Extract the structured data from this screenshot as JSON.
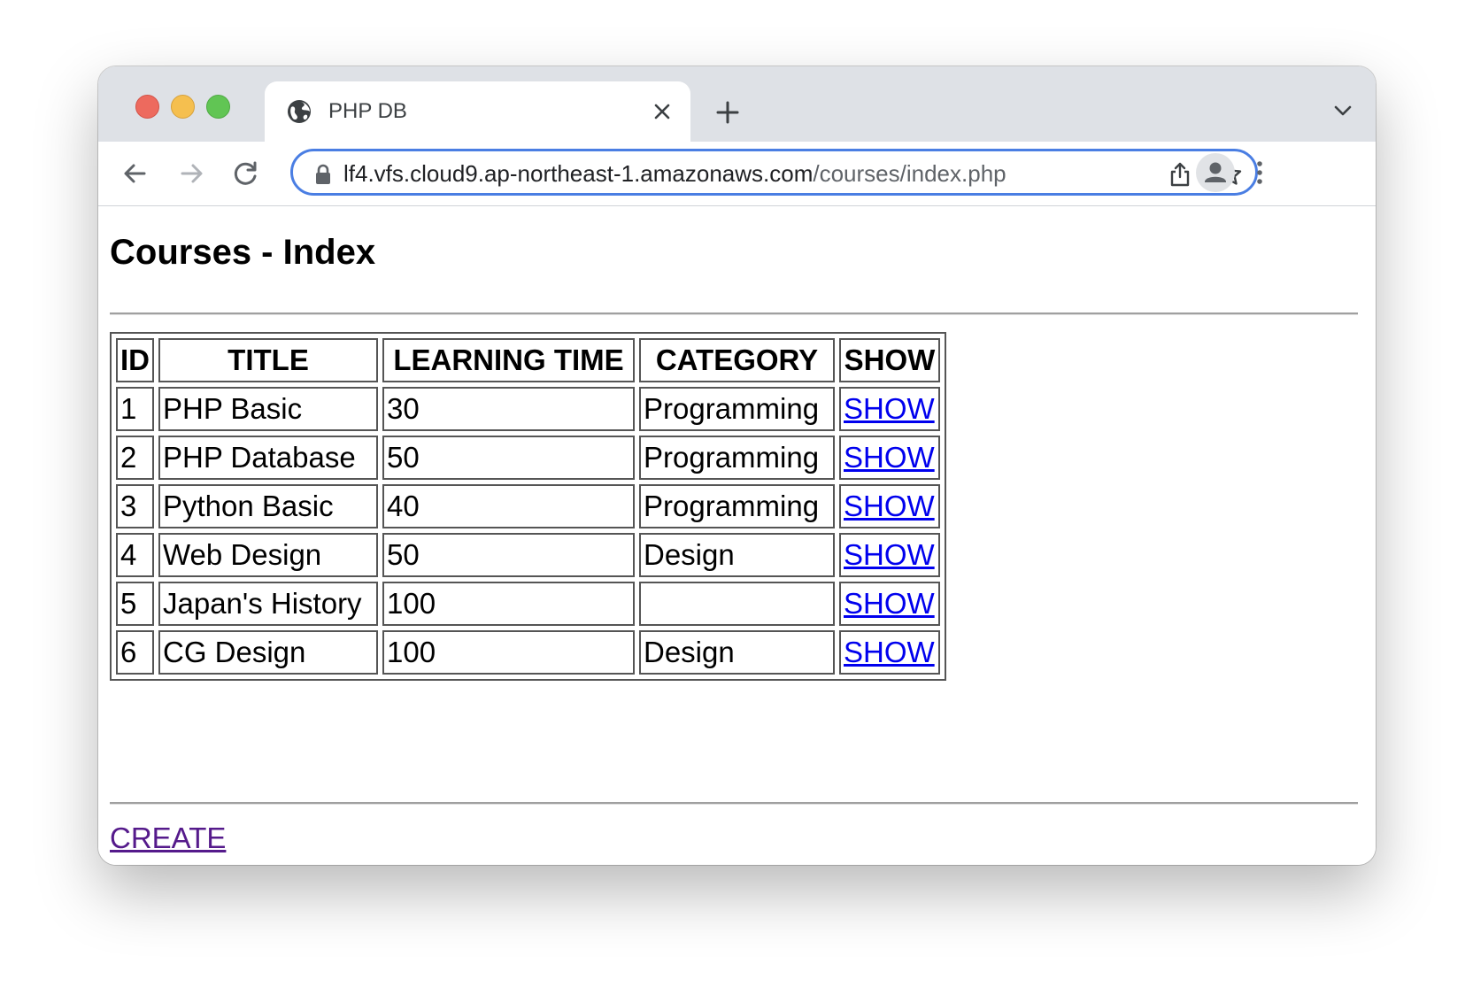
{
  "browser": {
    "tab_title": "PHP DB",
    "url_host": "lf4.vfs.cloud9.ap-northeast-1.amazonaws.com",
    "url_path": "/courses/index.php"
  },
  "page": {
    "title": "Courses - Index",
    "create_label": "CREATE"
  },
  "table": {
    "headers": {
      "id": "ID",
      "title": "TITLE",
      "learning_time": "LEARNING TIME",
      "category": "CATEGORY",
      "show": "SHOW"
    },
    "rows": [
      {
        "id": "1",
        "title": "PHP Basic",
        "learning_time": "30",
        "category": "Programming",
        "show": "SHOW"
      },
      {
        "id": "2",
        "title": "PHP Database",
        "learning_time": "50",
        "category": "Programming",
        "show": "SHOW"
      },
      {
        "id": "3",
        "title": "Python Basic",
        "learning_time": "40",
        "category": "Programming",
        "show": "SHOW"
      },
      {
        "id": "4",
        "title": "Web Design",
        "learning_time": "50",
        "category": "Design",
        "show": "SHOW"
      },
      {
        "id": "5",
        "title": "Japan's History",
        "learning_time": "100",
        "category": "",
        "show": "SHOW"
      },
      {
        "id": "6",
        "title": "CG Design",
        "learning_time": "100",
        "category": "Design",
        "show": "SHOW"
      }
    ]
  },
  "colors": {
    "link": "#0000ee",
    "visited_link": "#551a8b",
    "omnibox_focus": "#4a7ee3",
    "traffic_close": "#ed6a5e",
    "traffic_minimize": "#f5bf4f",
    "traffic_maximize": "#61c554"
  },
  "icons": {
    "tab": "globe-icon",
    "tab_close": "close-icon",
    "new_tab": "plus-icon",
    "tab_menu": "chevron-down-icon",
    "back": "arrow-left-icon",
    "forward": "arrow-right-icon",
    "reload": "reload-icon",
    "secure": "lock-icon",
    "share": "share-icon",
    "bookmark": "star-icon",
    "profile": "avatar-icon",
    "menu": "kebab-menu-icon"
  }
}
